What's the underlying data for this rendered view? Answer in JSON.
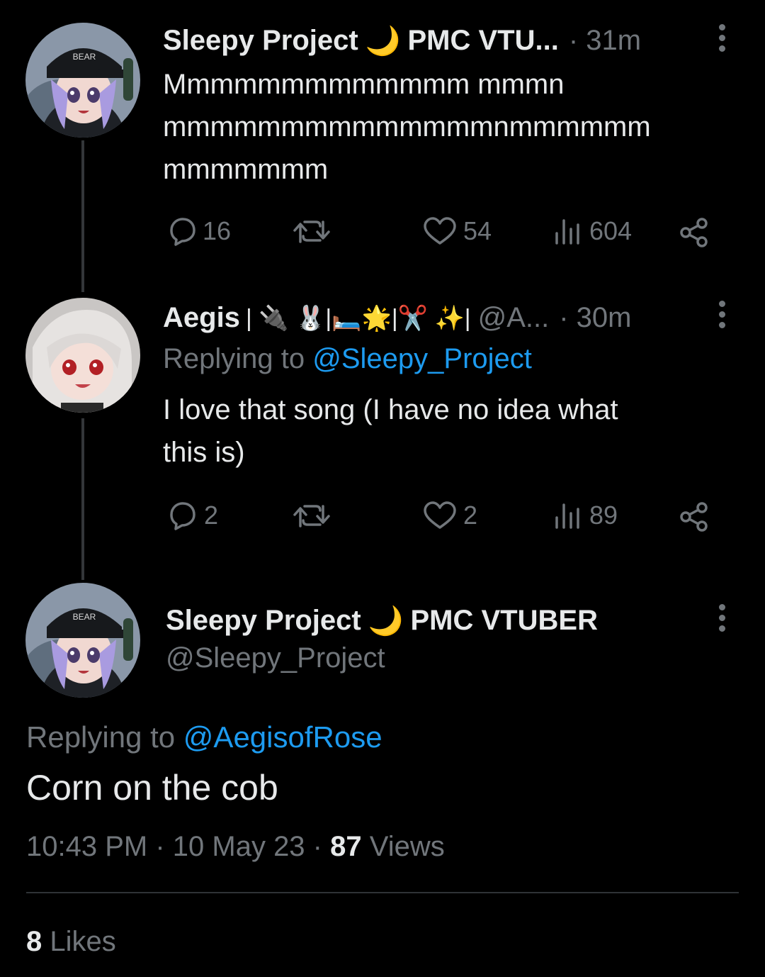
{
  "tweet1": {
    "display_name": "Sleepy Project",
    "moon": "🌙",
    "name_suffix": "PMC VTU...",
    "time": "· 31m",
    "text_line1": "Mmmmmmmmmmmmm mmmn",
    "text_line2": "mmmmmmmmmmmmmmnmmmmmm",
    "text_line3": "mmmmmmm",
    "replies": "16",
    "likes": "54",
    "views": "604",
    "avatar_badge": "BEAR"
  },
  "tweet2": {
    "display_name": "Aegis",
    "name_emojis": "| 🔌 🐰|🛏️🌟|✂️ ✨|",
    "handle": "@A...",
    "time": "· 30m",
    "replying_prefix": "Replying to",
    "replying_handle": "@Sleepy_Project",
    "text_line1": "I love that song (I have no idea what",
    "text_line2": "this is)",
    "replies": "2",
    "likes": "2",
    "views": "89"
  },
  "main_tweet": {
    "display_name": "Sleepy Project",
    "moon": "🌙",
    "name_suffix": "PMC VTUBER",
    "handle": "@Sleepy_Project",
    "replying_prefix": "Replying to",
    "replying_handle": "@AegisofRose",
    "text": "Corn on the cob",
    "time": "10:43 PM",
    "date": "· 10 May 23 ·",
    "view_count": "87",
    "views_label": "Views",
    "like_count": "8",
    "likes_label": "Likes",
    "avatar_badge": "BEAR"
  },
  "colors": {
    "background": "#000000",
    "text": "#e7e9ea",
    "secondary": "#71767b",
    "link": "#1d9bf0",
    "divider": "#2f3336"
  }
}
